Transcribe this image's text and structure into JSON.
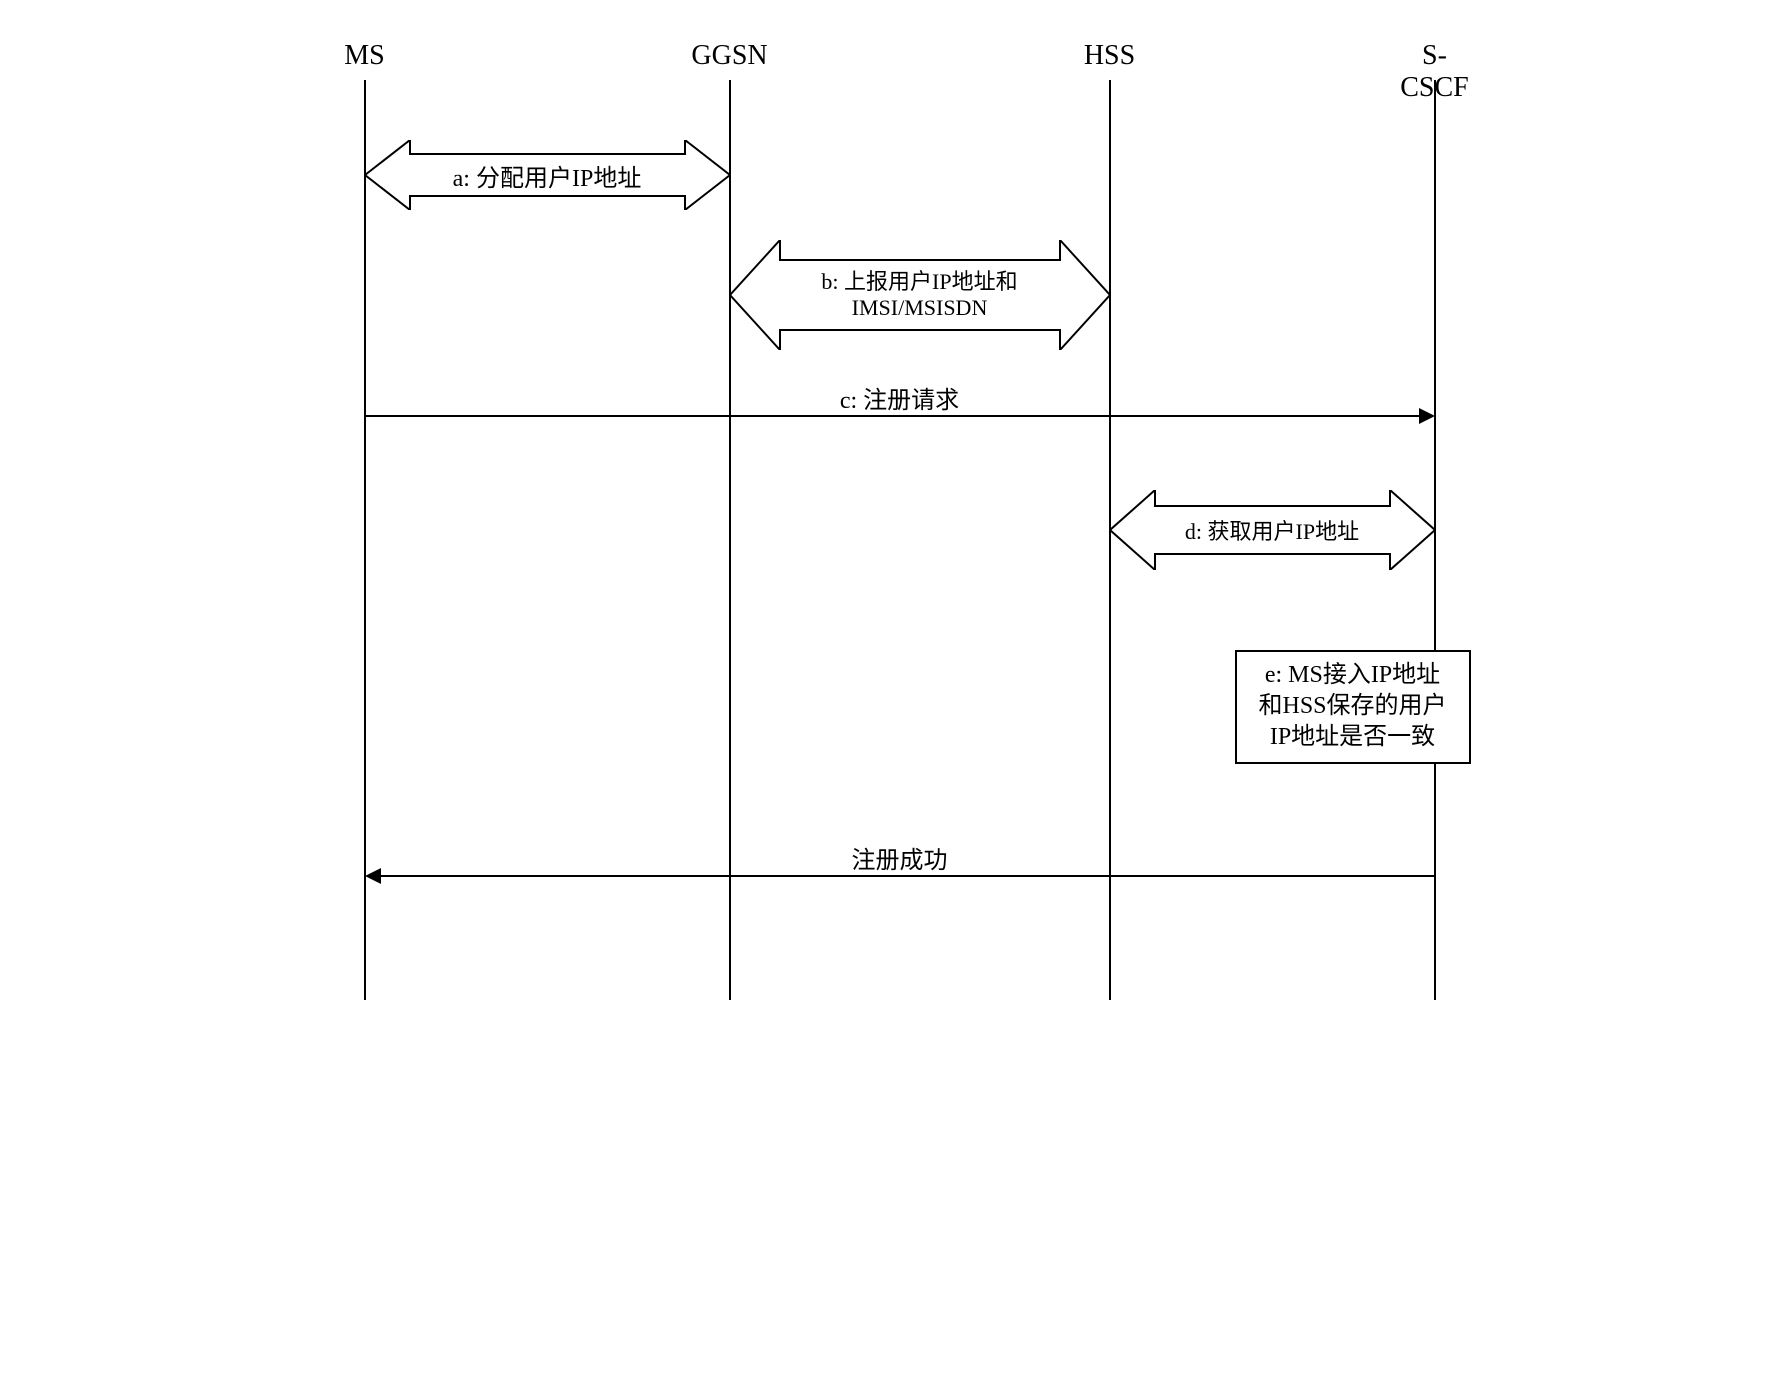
{
  "actors": {
    "ms": "MS",
    "ggsn": "GGSN",
    "hss": "HSS",
    "scscf": "S-CSCF"
  },
  "messages": {
    "a": "a: 分配用户IP地址",
    "b_line1": "b: 上报用户IP地址和",
    "b_line2": "IMSI/MSISDN",
    "c": "c: 注册请求",
    "d": "d: 获取用户IP地址",
    "e_line1": "e: MS接入IP地址",
    "e_line2": "和HSS保存的用户",
    "e_line3": "IP地址是否一致",
    "success": "注册成功"
  },
  "chart_data": {
    "type": "sequence-diagram",
    "actors": [
      "MS",
      "GGSN",
      "HSS",
      "S-CSCF"
    ],
    "steps": [
      {
        "id": "a",
        "from": "MS",
        "to": "GGSN",
        "direction": "bidirectional",
        "label": "分配用户IP地址"
      },
      {
        "id": "b",
        "from": "GGSN",
        "to": "HSS",
        "direction": "bidirectional",
        "label": "上报用户IP地址和IMSI/MSISDN"
      },
      {
        "id": "c",
        "from": "MS",
        "to": "S-CSCF",
        "direction": "right",
        "label": "注册请求"
      },
      {
        "id": "d",
        "from": "HSS",
        "to": "S-CSCF",
        "direction": "bidirectional",
        "label": "获取用户IP地址"
      },
      {
        "id": "e",
        "at": "S-CSCF",
        "type": "decision",
        "label": "MS接入IP地址和HSS保存的用户IP地址是否一致"
      },
      {
        "id": "success",
        "from": "S-CSCF",
        "to": "MS",
        "direction": "left",
        "label": "注册成功"
      }
    ]
  }
}
